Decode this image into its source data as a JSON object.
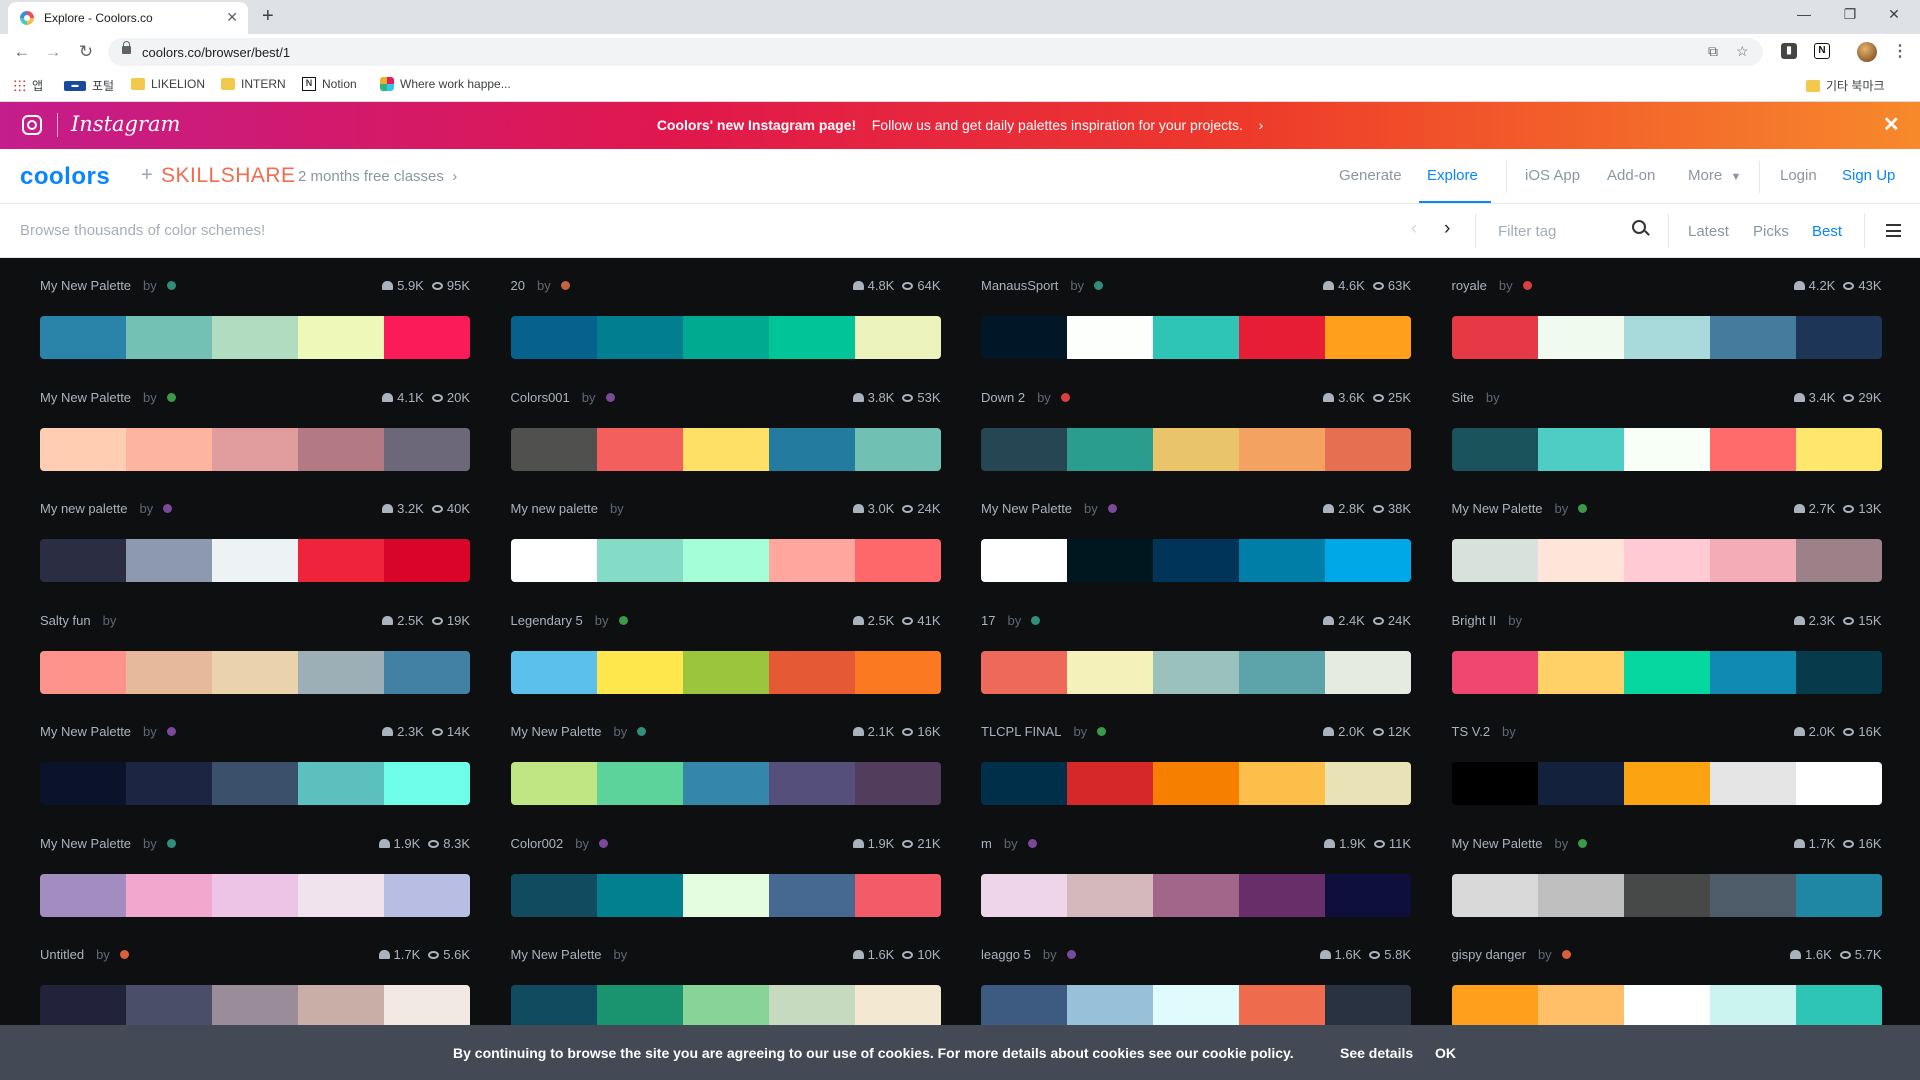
{
  "browser": {
    "tab_title": "Explore - Coolors.co",
    "url": "coolors.co/browser/best/1",
    "bookmarks": {
      "apps": "앱",
      "portal": "포털",
      "likelion": "LIKELION",
      "intern": "INTERN",
      "notion": "Notion",
      "slack": "Where work happe...",
      "other": "기타 북마크"
    }
  },
  "instagram_banner": {
    "wordmark": "Instagram",
    "headline": "Coolors' new Instagram page!",
    "message": "Follow us and get daily palettes inspiration for your projects."
  },
  "header": {
    "logo": "coolors",
    "plus": "+",
    "partner": "SKILLSHARE",
    "promo": "2 months free classes",
    "nav": {
      "generate": "Generate",
      "explore": "Explore",
      "ios": "iOS App",
      "addon": "Add-on",
      "more": "More",
      "login": "Login",
      "signup": "Sign Up"
    }
  },
  "filterbar": {
    "browse_placeholder": "Browse thousands of color schemes!",
    "filter_placeholder": "Filter tag",
    "sort": {
      "latest": "Latest",
      "picks": "Picks",
      "best": "Best"
    }
  },
  "accent_color": "#0a84ff",
  "palettes": [
    {
      "name": "My New Palette",
      "dot": "#2e8f7a",
      "likes": "5.9K",
      "views": "95K",
      "colors": [
        "#2a83a8",
        "#73c1b4",
        "#b2dcbf",
        "#eef8b9",
        "#fb1b58"
      ]
    },
    {
      "name": "20",
      "dot": "#c4643c",
      "likes": "4.8K",
      "views": "64K",
      "colors": [
        "#07618d",
        "#027e91",
        "#00aa91",
        "#00c599",
        "#edf3bd"
      ]
    },
    {
      "name": "ManausSport",
      "dot": "#2e8f7a",
      "likes": "4.6K",
      "views": "63K",
      "colors": [
        "#011626",
        "#fdfffc",
        "#2ec4b6",
        "#e71d36",
        "#ff9f1c"
      ]
    },
    {
      "name": "royale",
      "dot": "#d94040",
      "likes": "4.2K",
      "views": "43K",
      "colors": [
        "#e63946",
        "#f1faee",
        "#a8dadc",
        "#457b9d",
        "#1d3557"
      ]
    },
    {
      "name": "My New Palette",
      "dot": "#3a9a4a",
      "likes": "4.1K",
      "views": "20K",
      "colors": [
        "#fecdb2",
        "#fdb5a0",
        "#e19c9e",
        "#b37a84",
        "#6c6779"
      ]
    },
    {
      "name": "Colors001",
      "dot": "#7a4a9a",
      "likes": "3.8K",
      "views": "53K",
      "colors": [
        "#50514f",
        "#f25f5c",
        "#ffe066",
        "#247ba0",
        "#70c1b3"
      ]
    },
    {
      "name": "Down 2",
      "dot": "#d94040",
      "likes": "3.6K",
      "views": "25K",
      "colors": [
        "#264653",
        "#2a9d8f",
        "#e9c46a",
        "#f4a261",
        "#e76f51"
      ]
    },
    {
      "name": "Site",
      "dot": "",
      "likes": "3.4K",
      "views": "29K",
      "colors": [
        "#1a535c",
        "#4ecdc4",
        "#f7fff7",
        "#ff6b6b",
        "#ffe66d"
      ]
    },
    {
      "name": "My new palette",
      "dot": "#7a4a9a",
      "likes": "3.2K",
      "views": "40K",
      "colors": [
        "#2b2d42",
        "#8d99ae",
        "#edf2f4",
        "#ef233c",
        "#d90429"
      ]
    },
    {
      "name": "My new palette",
      "dot": "",
      "likes": "3.0K",
      "views": "24K",
      "colors": [
        "#ffffff",
        "#84dcc6",
        "#a5ffd6",
        "#ffa69e",
        "#ff686b"
      ]
    },
    {
      "name": "My New Palette",
      "dot": "#7a4a9a",
      "likes": "2.8K",
      "views": "38K",
      "colors": [
        "#ffffff",
        "#00171f",
        "#003459",
        "#007ea7",
        "#00a8e8"
      ]
    },
    {
      "name": "My New Palette",
      "dot": "#3a9a4a",
      "likes": "2.7K",
      "views": "13K",
      "colors": [
        "#d8e2dc",
        "#ffe5d9",
        "#ffcad4",
        "#f4acb7",
        "#9d8189"
      ]
    },
    {
      "name": "Salty fun",
      "dot": "",
      "likes": "2.5K",
      "views": "19K",
      "colors": [
        "#fe938c",
        "#e6b89c",
        "#ead2ac",
        "#9cafb7",
        "#4281a4"
      ]
    },
    {
      "name": "Legendary 5",
      "dot": "#3a9a4a",
      "likes": "2.5K",
      "views": "41K",
      "colors": [
        "#5bc0eb",
        "#fde74c",
        "#9bc53d",
        "#e55934",
        "#fa7921"
      ]
    },
    {
      "name": "17",
      "dot": "#2e8f7a",
      "likes": "2.4K",
      "views": "24K",
      "colors": [
        "#ed6a5a",
        "#f4f1bb",
        "#9bc1bc",
        "#5ca4a9",
        "#e6ebe0"
      ]
    },
    {
      "name": "Bright II",
      "dot": "",
      "likes": "2.3K",
      "views": "15K",
      "colors": [
        "#ef476f",
        "#ffd166",
        "#06d6a0",
        "#118ab2",
        "#073b4c"
      ]
    },
    {
      "name": "My New Palette",
      "dot": "#7a4a9a",
      "likes": "2.3K",
      "views": "14K",
      "colors": [
        "#0b132b",
        "#1c2541",
        "#3a506b",
        "#5bc0be",
        "#6fffe9"
      ]
    },
    {
      "name": "My New Palette",
      "dot": "#2e8f7a",
      "likes": "2.1K",
      "views": "16K",
      "colors": [
        "#bfe682",
        "#5bd39b",
        "#3487a9",
        "#554f7b",
        "#533d5d"
      ]
    },
    {
      "name": "TLCPL FINAL",
      "dot": "#3a9a4a",
      "likes": "2.0K",
      "views": "12K",
      "colors": [
        "#003049",
        "#d62828",
        "#f77f00",
        "#fcbf49",
        "#eae2b7"
      ]
    },
    {
      "name": "TS V.2",
      "dot": "",
      "likes": "2.0K",
      "views": "16K",
      "colors": [
        "#000000",
        "#14213d",
        "#fca311",
        "#e5e5e5",
        "#ffffff"
      ]
    },
    {
      "name": "My New Palette",
      "dot": "#2e8f7a",
      "likes": "1.9K",
      "views": "8.3K",
      "colors": [
        "#a28cc0",
        "#f2a8ce",
        "#eec4e6",
        "#f0e3ee",
        "#b7bde3"
      ]
    },
    {
      "name": "Color002",
      "dot": "#7a4a9a",
      "likes": "1.9K",
      "views": "21K",
      "colors": [
        "#114b5f",
        "#028090",
        "#e4fde1",
        "#456990",
        "#f45b69"
      ]
    },
    {
      "name": "m",
      "dot": "#7a4a9a",
      "likes": "1.9K",
      "views": "11K",
      "colors": [
        "#efd5ea",
        "#d4b8bb",
        "#a2668a",
        "#682e6a",
        "#0f0f3d"
      ]
    },
    {
      "name": "My New Palette",
      "dot": "#3a9a4a",
      "likes": "1.7K",
      "views": "16K",
      "colors": [
        "#d9d9d9",
        "#c0bfc0",
        "#474848",
        "#4f5d6a",
        "#1f86a4"
      ]
    },
    {
      "name": "Untitled",
      "dot": "#d9603c",
      "likes": "1.7K",
      "views": "5.6K",
      "colors": [
        "#22223b",
        "#4a4e69",
        "#9a8c98",
        "#c9ada7",
        "#f2e9e4"
      ]
    },
    {
      "name": "My New Palette",
      "dot": "",
      "likes": "1.6K",
      "views": "10K",
      "colors": [
        "#114b5f",
        "#1a936f",
        "#88d498",
        "#c6dabf",
        "#f3e9d2"
      ]
    },
    {
      "name": "leaggo 5",
      "dot": "#7a4a9a",
      "likes": "1.6K",
      "views": "5.8K",
      "colors": [
        "#3d5a80",
        "#98c1d9",
        "#e0fbfc",
        "#ee6c4d",
        "#293241"
      ]
    },
    {
      "name": "gispy danger",
      "dot": "#d9603c",
      "likes": "1.6K",
      "views": "5.7K",
      "colors": [
        "#ff9f1c",
        "#ffbf69",
        "#ffffff",
        "#cbf3f0",
        "#2ec4b6"
      ]
    }
  ],
  "cookie_bar": {
    "text": "By continuing to browse the site you are agreeing to our use of cookies. For more details about cookies see our cookie policy.",
    "see_details": "See details",
    "ok": "OK"
  }
}
